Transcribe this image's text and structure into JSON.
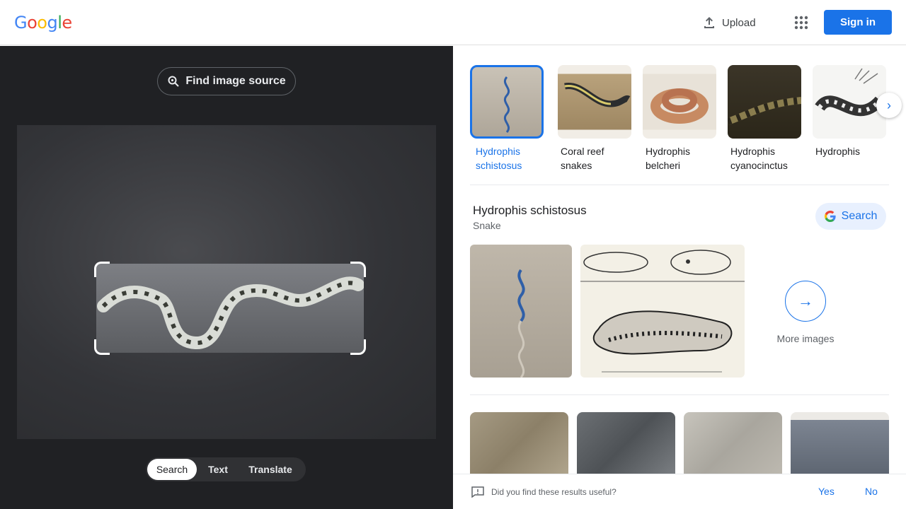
{
  "header": {
    "logo_letters": [
      "G",
      "o",
      "o",
      "g",
      "l",
      "e"
    ],
    "logo_colors": [
      "#4285f4",
      "#ea4335",
      "#fbbc05",
      "#4285f4",
      "#34a853",
      "#ea4335"
    ],
    "upload_label": "Upload",
    "apps_icon": "apps-grid-icon",
    "signin_label": "Sign in"
  },
  "lens": {
    "find_source_label": "Find image source",
    "modes": [
      {
        "label": "Search",
        "active": true
      },
      {
        "label": "Text",
        "active": false
      },
      {
        "label": "Translate",
        "active": false
      }
    ]
  },
  "results": {
    "chips": [
      {
        "label": "Hydrophis schistosus",
        "selected": true
      },
      {
        "label": "Coral reef snakes",
        "selected": false
      },
      {
        "label": "Hydrophis belcheri",
        "selected": false
      },
      {
        "label": "Hydrophis cyanocinctus",
        "selected": false
      },
      {
        "label": "Hydrophis",
        "selected": false
      }
    ],
    "knowledge": {
      "title": "Hydrophis schistosus",
      "subtitle": "Snake",
      "search_label": "Search",
      "more_images_label": "More images"
    },
    "feedback": {
      "question": "Did you find these results useful?",
      "yes": "Yes",
      "no": "No"
    }
  },
  "colors": {
    "accent": "#1a73e8",
    "left_panel_bg": "#202124"
  }
}
